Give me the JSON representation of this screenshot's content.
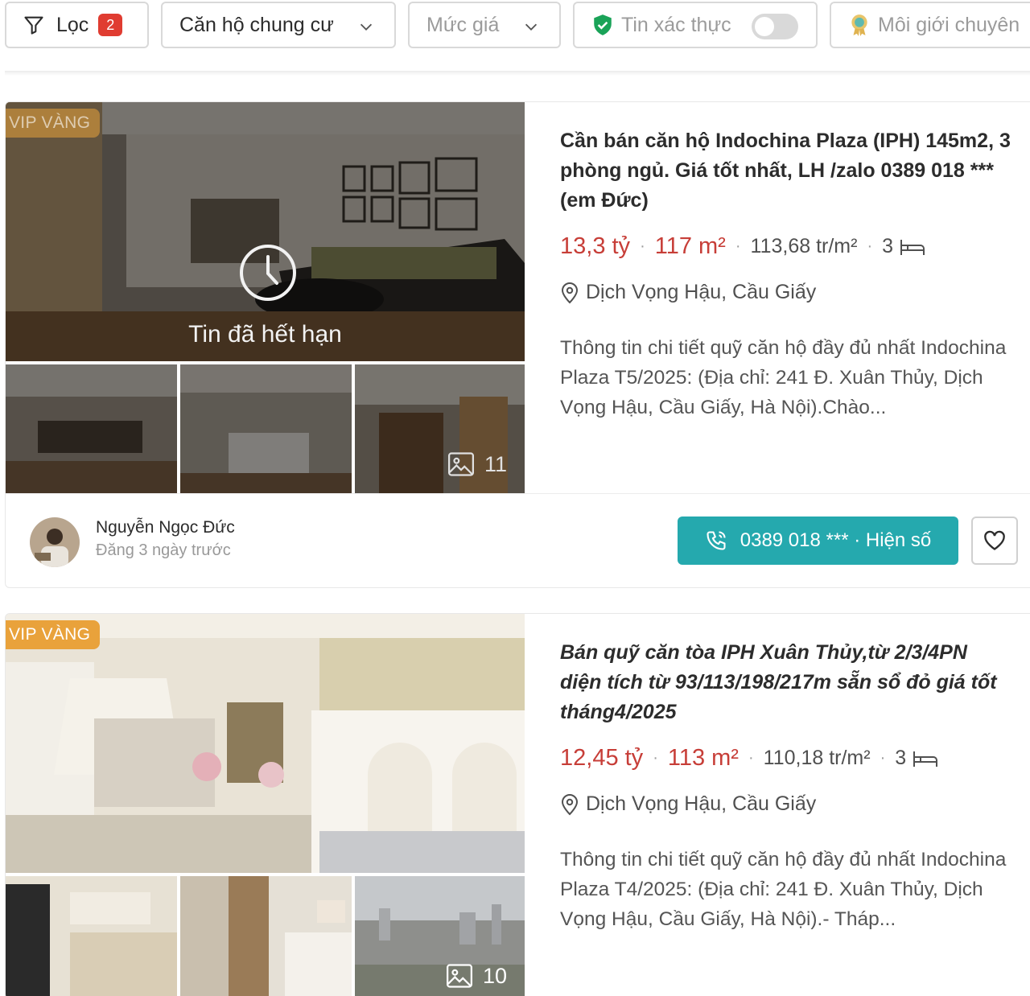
{
  "filters": {
    "filter_label": "Lọc",
    "filter_count": "2",
    "property_type": "Căn hộ chung cư",
    "price_placeholder": "Mức giá",
    "verified_label": "Tin xác thực",
    "verified_on": false,
    "broker_label": "Môi giới chuyên"
  },
  "listings": [
    {
      "badge": "VIP VÀNG",
      "expired_text": "Tin đã hết hạn",
      "image_count": "11",
      "title": "Cần bán căn hộ Indochina Plaza (IPH) 145m2, 3 phòng ngủ. Giá tốt nhất, LH /zalo 0389 018 *** (em Đức)",
      "price": "13,3 tỷ",
      "area": "117 m²",
      "price_per_m2": "113,68 tr/m²",
      "bedrooms": "3",
      "location": "Dịch Vọng Hậu, Cầu Giấy",
      "description": "Thông tin chi tiết quỹ căn hộ đầy đủ nhất Indochina Plaza T5/2025: (Địa chỉ: 241 Đ. Xuân Thủy, Dịch Vọng Hậu, Cầu Giấy, Hà Nội).Chào...",
      "author": "Nguyễn Ngọc Đức",
      "posted": "Đăng 3 ngày trước",
      "phone_button": "0389 018 *** · Hiện số"
    },
    {
      "badge": "VIP VÀNG",
      "image_count": "10",
      "title": "Bán quỹ căn tòa IPH Xuân Thủy,từ 2/3/4PN diện tích từ 93/113/198/217m sẵn sổ đỏ giá tốt tháng4/2025",
      "price": "12,45 tỷ",
      "area": "113 m²",
      "price_per_m2": "110,18 tr/m²",
      "bedrooms": "3",
      "location": "Dịch Vọng Hậu, Cầu Giấy",
      "description": "Thông tin chi tiết quỹ căn hộ đầy đủ nhất Indochina Plaza T4/2025: (Địa chỉ: 241 Đ. Xuân Thủy, Dịch Vọng Hậu, Cầu Giấy, Hà Nội).- Tháp..."
    }
  ],
  "colors": {
    "price": "#c73e38",
    "vip_badge": "#e9a23b",
    "phone_button": "#009ba1",
    "filter_badge": "#e03c31",
    "verified_icon": "#1aa358"
  },
  "icons": {
    "filter": "funnel-icon",
    "chevron": "chevron-down-icon",
    "verified": "shield-check-icon",
    "broker": "award-icon",
    "expired": "clock-icon",
    "images": "image-icon",
    "location": "map-pin-icon",
    "bed": "bed-icon",
    "phone": "phone-icon",
    "favorite": "heart-icon"
  }
}
